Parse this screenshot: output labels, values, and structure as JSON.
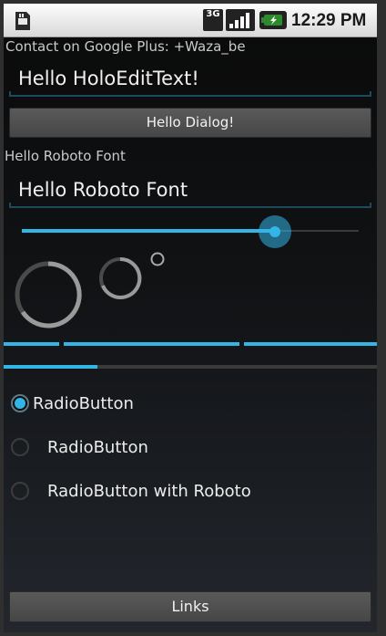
{
  "status_bar": {
    "network_label": "3G",
    "time": "12:29 PM"
  },
  "contact_text": "Contact on Google Plus: +Waza_be",
  "edit_text_1": {
    "value": "Hello HoloEditText!"
  },
  "dialog_button": {
    "label": "Hello Dialog!"
  },
  "roboto_label": "Hello Roboto Font",
  "edit_text_2": {
    "value": "Hello Roboto Font"
  },
  "seekbar": {
    "progress": 0.75
  },
  "progress_bar": {
    "progress": 0.25
  },
  "radios": [
    {
      "label": "RadioButton",
      "checked": true
    },
    {
      "label": "RadioButton",
      "checked": false
    },
    {
      "label": "RadioButton with Roboto",
      "checked": false
    }
  ],
  "links_button": {
    "label": "Links"
  },
  "colors": {
    "accent": "#33b5e5",
    "background": "#0a0a0a"
  }
}
